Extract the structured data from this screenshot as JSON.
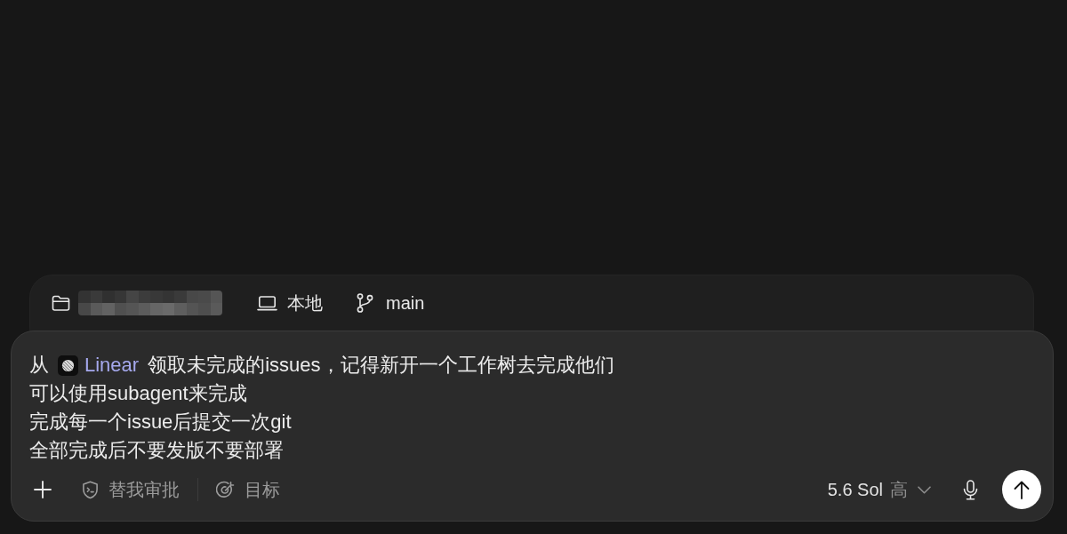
{
  "context_bar": {
    "items": [
      {
        "kind": "folder"
      },
      {
        "kind": "environment",
        "label": "本地"
      },
      {
        "kind": "branch",
        "label": "main"
      }
    ]
  },
  "composer": {
    "lines": [
      {
        "segments": [
          {
            "kind": "text",
            "text": "从"
          },
          {
            "kind": "mention",
            "text": "Linear"
          },
          {
            "kind": "text",
            "text": "领取未完成的issues，记得新开一个工作树去完成他们"
          }
        ]
      },
      {
        "segments": [
          {
            "kind": "text",
            "text": "可以使用subagent来完成"
          }
        ]
      },
      {
        "segments": [
          {
            "kind": "text",
            "text": "完成每一个issue后提交一次git"
          }
        ]
      },
      {
        "segments": [
          {
            "kind": "text",
            "text": "全部完成后不要发版不要部署"
          }
        ]
      }
    ],
    "toolbar": {
      "items": [
        {
          "kind": "add"
        },
        {
          "kind": "approval",
          "label": "替我审批"
        },
        {
          "kind": "divider"
        },
        {
          "kind": "goal",
          "label": "目标"
        }
      ],
      "model": {
        "name": "5.6 Sol",
        "effort": "高"
      }
    }
  }
}
